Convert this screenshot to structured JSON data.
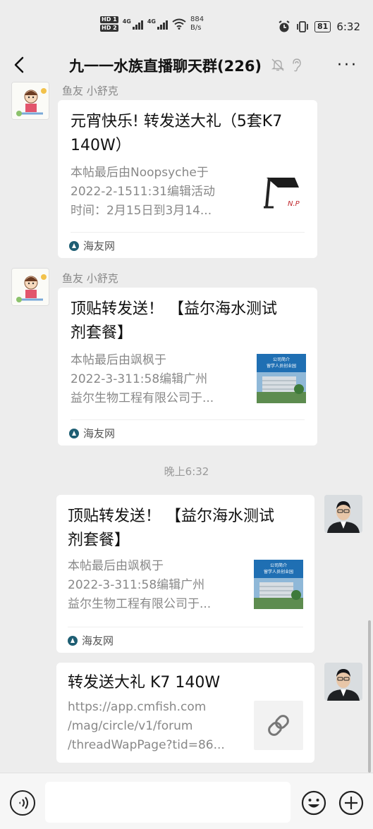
{
  "status": {
    "hd1": "HD 1",
    "hd2": "HD 2",
    "net1": "4G",
    "net2": "4G",
    "speed_value": "884",
    "speed_unit": "B/s",
    "battery": "81",
    "time": "6:32"
  },
  "header": {
    "title": "九一一水族直播聊天群(226)",
    "more": "···"
  },
  "messages": [
    {
      "sender": "鱼友 小舒克",
      "title_l1": "元宵快乐! 转发送大礼（5套K7",
      "title_l2": "140W）",
      "desc_l1": "本帖最后由Noopsyche于",
      "desc_l2": "2022-2-1511:31编辑活动",
      "desc_l3": "时间：2月15日到3月14...",
      "source": "海友网"
    },
    {
      "sender": "鱼友 小舒克",
      "title_l1": "顶贴转发送！ 【益尔海水测试",
      "title_l2": "剂套餐】",
      "desc_l1": "本帖最后由飒枫于",
      "desc_l2": "2022-3-311:58编辑广州",
      "desc_l3": "益尔生物工程有限公司于...",
      "source": "海友网"
    },
    {
      "title_l1": "顶贴转发送！ 【益尔海水测试",
      "title_l2": "剂套餐】",
      "desc_l1": "本帖最后由飒枫于",
      "desc_l2": "2022-3-311:58编辑广州",
      "desc_l3": "益尔生物工程有限公司于...",
      "source": "海友网"
    },
    {
      "title": "转发送大礼 K7 140W",
      "url_l1": "https://app.cmfish.com",
      "url_l2": "/mag/circle/v1/forum",
      "url_l3": "/threadWapPage?tid=86..."
    }
  ],
  "timestamp": "晚上6:32",
  "thumb_text": {
    "logo": "N.P",
    "banner_l1": "公司简介",
    "banner_l2": "留学人员创业园"
  },
  "colors": {
    "background": "#ededed",
    "card": "#ffffff",
    "muted_text": "#888888",
    "source_icon": "#1e5e73"
  },
  "icons": [
    "back-arrow-icon",
    "mute-bell-icon",
    "earpiece-icon",
    "more-icon",
    "link-icon",
    "voice-icon",
    "emoji-icon",
    "plus-icon"
  ]
}
